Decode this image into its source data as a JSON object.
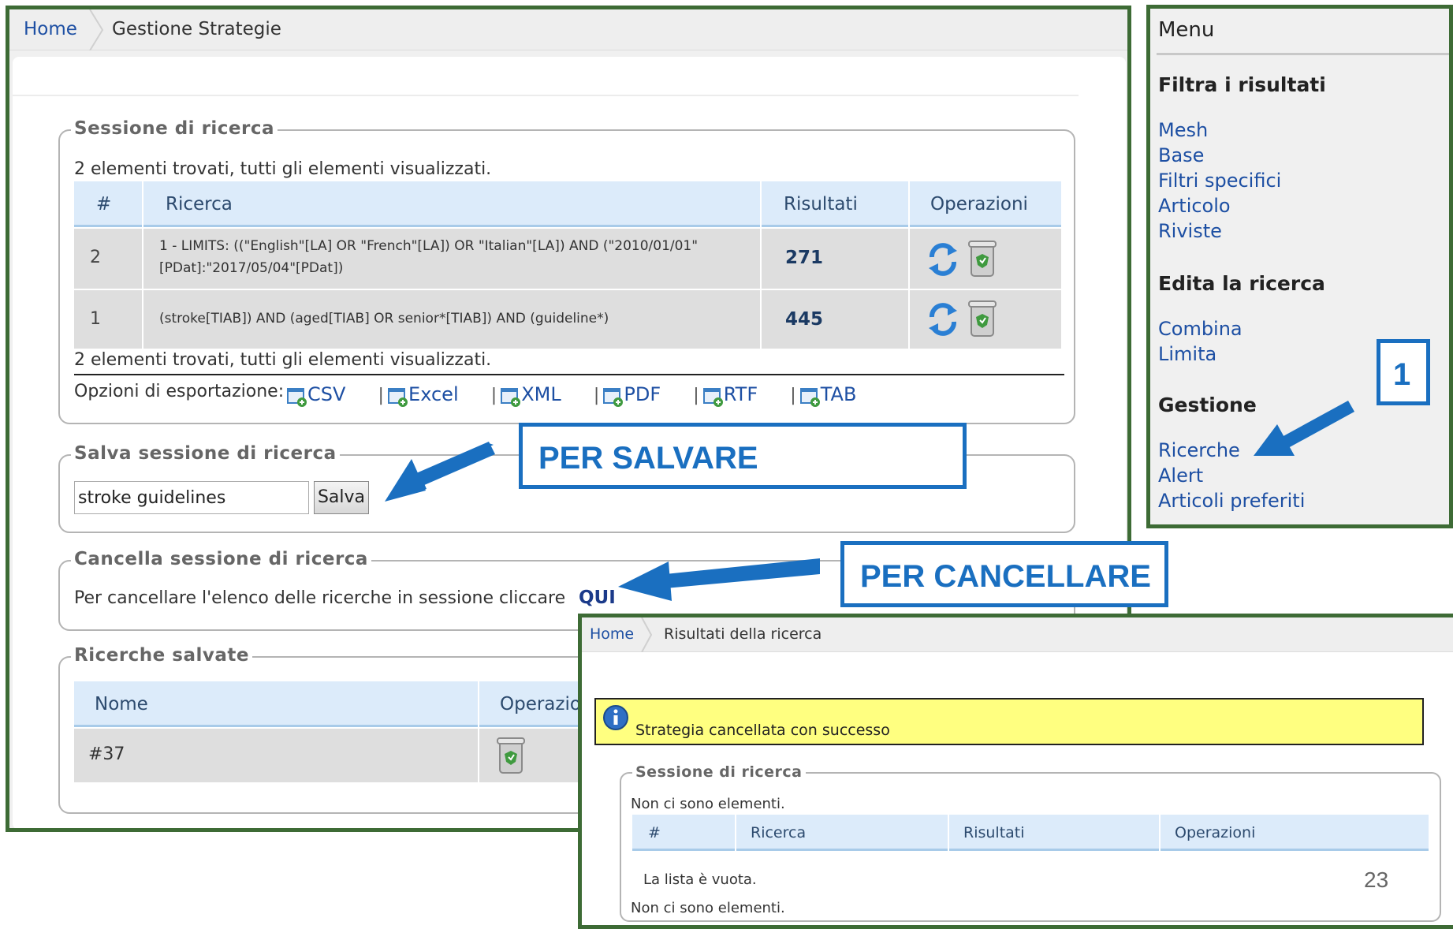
{
  "main": {
    "breadcrumb": {
      "home": "Home",
      "current": "Gestione Strategie"
    },
    "session": {
      "legend": "Sessione di ricerca",
      "summary_top": "2 elementi trovati, tutti gli elementi visualizzati.",
      "summary_bottom": "2 elementi trovati, tutti gli elementi visualizzati.",
      "columns": [
        "#",
        "Ricerca",
        "Risultati",
        "Operazioni"
      ],
      "rows": [
        {
          "num": "2",
          "query_line1": "1 - LIMITS: ((\"English\"[LA] OR \"French\"[LA]) OR \"Italian\"[LA]) AND (\"2010/01/01\"",
          "query_line2": "[PDat]:\"2017/05/04\"[PDat])",
          "results": "271"
        },
        {
          "num": "1",
          "query_line1": "(stroke[TIAB]) AND (aged[TIAB] OR senior*[TIAB]) AND (guideline*)",
          "query_line2": "",
          "results": "445"
        }
      ],
      "export_label": "Opzioni di esportazione:",
      "export_options": [
        "CSV",
        "Excel",
        "XML",
        "PDF",
        "RTF",
        "TAB"
      ]
    },
    "save": {
      "legend": "Salva sessione di ricerca",
      "input_value": "stroke guidelines",
      "button": "Salva"
    },
    "delete": {
      "legend": "Cancella sessione di ricerca",
      "text": "Per cancellare l'elenco delle ricerche in sessione cliccare",
      "link": "QUI"
    },
    "saved": {
      "legend": "Ricerche salvate",
      "columns": [
        "Nome",
        "Operazio"
      ],
      "rows": [
        {
          "name": "#37"
        }
      ]
    }
  },
  "menu": {
    "title": "Menu",
    "sections": [
      {
        "heading": "Filtra i risultati",
        "items": [
          "Mesh",
          "Base",
          "Filtri specifici",
          "Articolo",
          "Riviste"
        ]
      },
      {
        "heading": "Edita la ricerca",
        "items": [
          "Combina",
          "Limita"
        ]
      },
      {
        "heading": "Gestione",
        "items": [
          "Ricerche",
          "Alert",
          "Articoli preferiti"
        ]
      }
    ]
  },
  "annotations": {
    "save_label": "PER SALVARE",
    "delete_label": "PER CANCELLARE",
    "step_number": "1",
    "color": "#1a6fc0"
  },
  "result": {
    "breadcrumb": {
      "home": "Home",
      "current": "Risultati della ricerca"
    },
    "notice": "Strategia cancellata con successo",
    "legend": "Sessione di ricerca",
    "empty_top": "Non ci sono elementi.",
    "columns": [
      "#",
      "Ricerca",
      "Risultati",
      "Operazioni"
    ],
    "empty_list": "La lista è vuota.",
    "empty_bottom": "Non ci sono elementi."
  },
  "page_number": "23",
  "colors": {
    "frame": "#3d6b35",
    "link": "#1d4fa3",
    "table_header": "#dcebfa",
    "notice_bg": "#ffff80"
  }
}
